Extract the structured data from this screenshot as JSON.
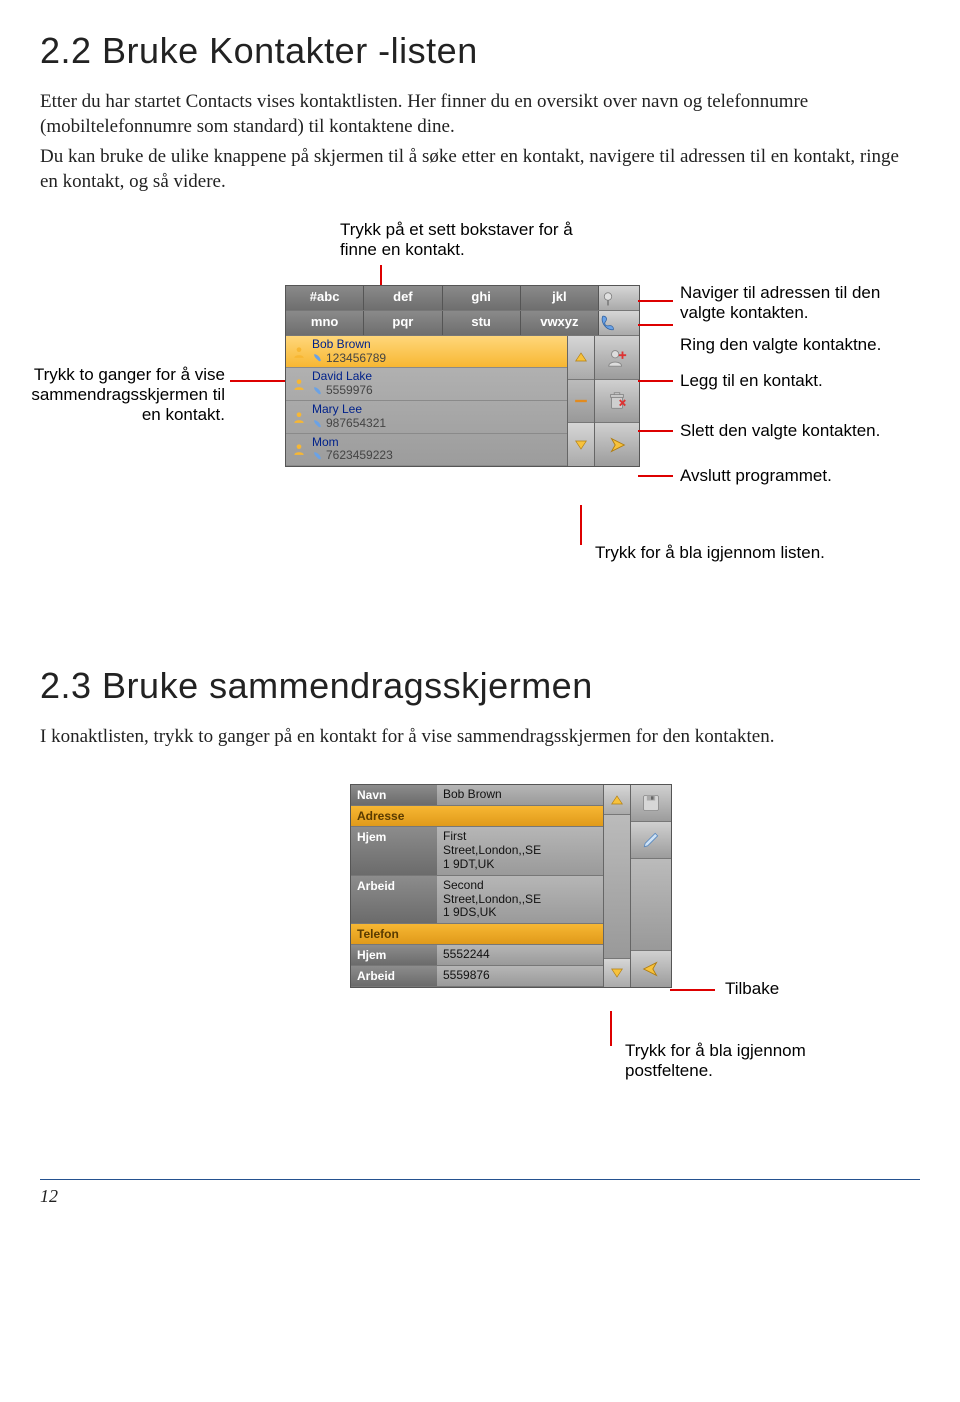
{
  "section22": {
    "heading": "2.2   Bruke Kontakter -listen",
    "para1": "Etter du har startet Contacts vises kontaktlisten. Her finner du en oversikt over navn og telefonnumre (mobiltelefonnumre som standard) til kontaktene dine.",
    "para2": "Du kan bruke de ulike knappene på skjermen til å søke etter en kontakt, navigere til adressen til en kontakt, ringe en kontakt, og så videre."
  },
  "callouts1": {
    "top": "Trykk på et sett bokstaver for å finne en kontakt.",
    "left": "Trykk to ganger for å vise sammendragsskjermen til en kontakt.",
    "right": {
      "nav": "Naviger til adressen til den valgte kontakten.",
      "call": "Ring den valgte kontaktne.",
      "add": "Legg til en kontakt.",
      "delete": "Slett den valgte kontakten.",
      "exit": "Avslutt programmet."
    },
    "bottom": "Trykk for å bla igjennom listen."
  },
  "phone_ui": {
    "tabs_row1": [
      "#abc",
      "def",
      "ghi",
      "jkl"
    ],
    "tabs_row2": [
      "mno",
      "pqr",
      "stu",
      "vwxyz"
    ],
    "contacts": [
      {
        "name": "Bob Brown",
        "phone": "123456789"
      },
      {
        "name": "David Lake",
        "phone": "5559976"
      },
      {
        "name": "Mary Lee",
        "phone": "987654321"
      },
      {
        "name": "Mom",
        "phone": "7623459223"
      }
    ]
  },
  "section23": {
    "heading": "2.3   Bruke sammendragsskjermen",
    "para": "I konaktlisten, trykk to ganger på en kontakt for å vise sammendragsskjermen for den kontakten."
  },
  "summary_ui": {
    "rows": [
      {
        "label": "Navn",
        "value": "Bob Brown",
        "section": false
      },
      {
        "label": "Adresse",
        "value": "",
        "section": true
      },
      {
        "label": "Hjem",
        "value": "First\nStreet,London,,SE\n1 9DT,UK",
        "section": false
      },
      {
        "label": "Arbeid",
        "value": "Second\nStreet,London,,SE\n1 9DS,UK",
        "section": false
      },
      {
        "label": "Telefon",
        "value": "",
        "section": true
      },
      {
        "label": "Hjem",
        "value": "5552244",
        "section": false
      },
      {
        "label": "Arbeid",
        "value": "5559876",
        "section": false
      }
    ]
  },
  "callouts2": {
    "back": "Tilbake",
    "scroll": "Trykk for å bla igjennom postfeltene."
  },
  "page_number": "12"
}
